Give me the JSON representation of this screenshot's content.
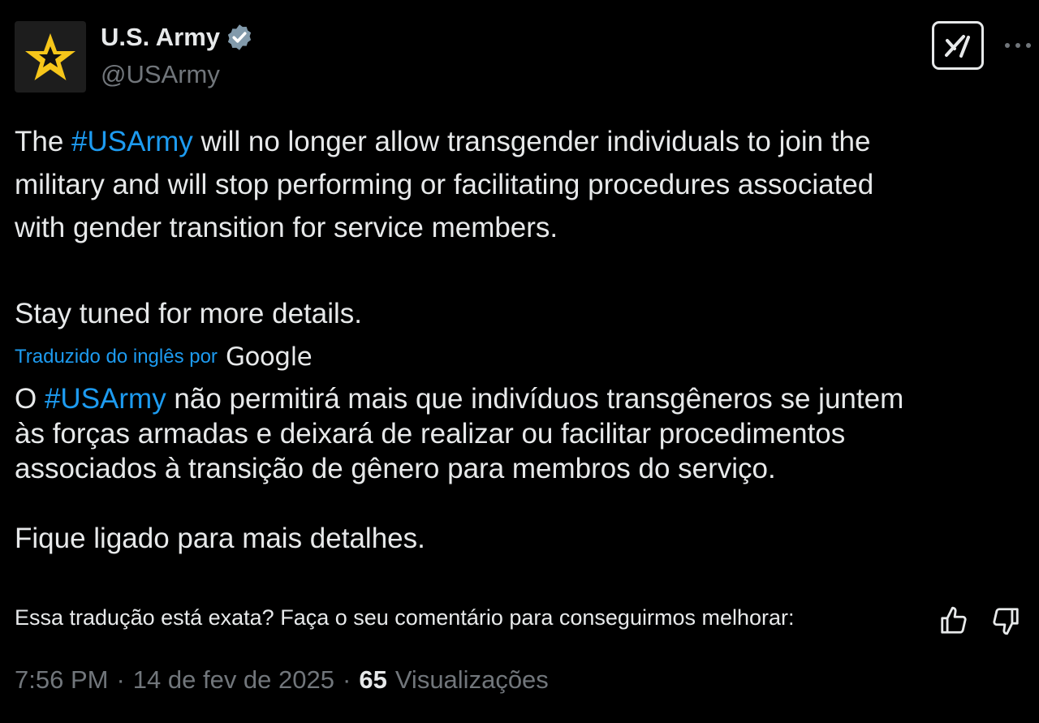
{
  "author": {
    "display_name": "U.S. Army",
    "handle": "@USArmy",
    "avatar_icon": "gold-star-icon",
    "verified_icon": "verified-badge-icon"
  },
  "header": {
    "grok_icon": "grok-icon",
    "more_icon": "more-options-icon"
  },
  "tweet": {
    "line1_prefix": "The ",
    "hashtag": "#USArmy",
    "line1_suffix": " will no longer allow transgender individuals to join the",
    "line2": "military and will stop performing or facilitating procedures associated",
    "line3": "with gender transition for service members.",
    "closing": "Stay tuned for more details."
  },
  "translation": {
    "label": "Traduzido do inglês por",
    "provider": "Google",
    "line1_prefix": "O ",
    "hashtag": "#USArmy",
    "line1_suffix": " não permitirá mais que indivíduos transgêneros se juntem",
    "line2": "às forças armadas e deixará de realizar ou facilitar procedimentos",
    "line3": "associados à transição de gênero para membros do serviço.",
    "closing": "Fique ligado para mais detalhes."
  },
  "feedback": {
    "question": "Essa tradução está exata? Faça o seu comentário para conseguirmos melhorar:",
    "thumbs_up_icon": "thumbs-up-icon",
    "thumbs_down_icon": "thumbs-down-icon"
  },
  "meta": {
    "time": "7:56 PM",
    "separator": "·",
    "date": "14 de fev de 2025",
    "views_count": "65",
    "views_label": "Visualizações"
  },
  "colors": {
    "background": "#000000",
    "text": "#e7e9ea",
    "secondary": "#71767b",
    "link": "#1d9bf0",
    "avatar_star": "#f6c61a"
  }
}
